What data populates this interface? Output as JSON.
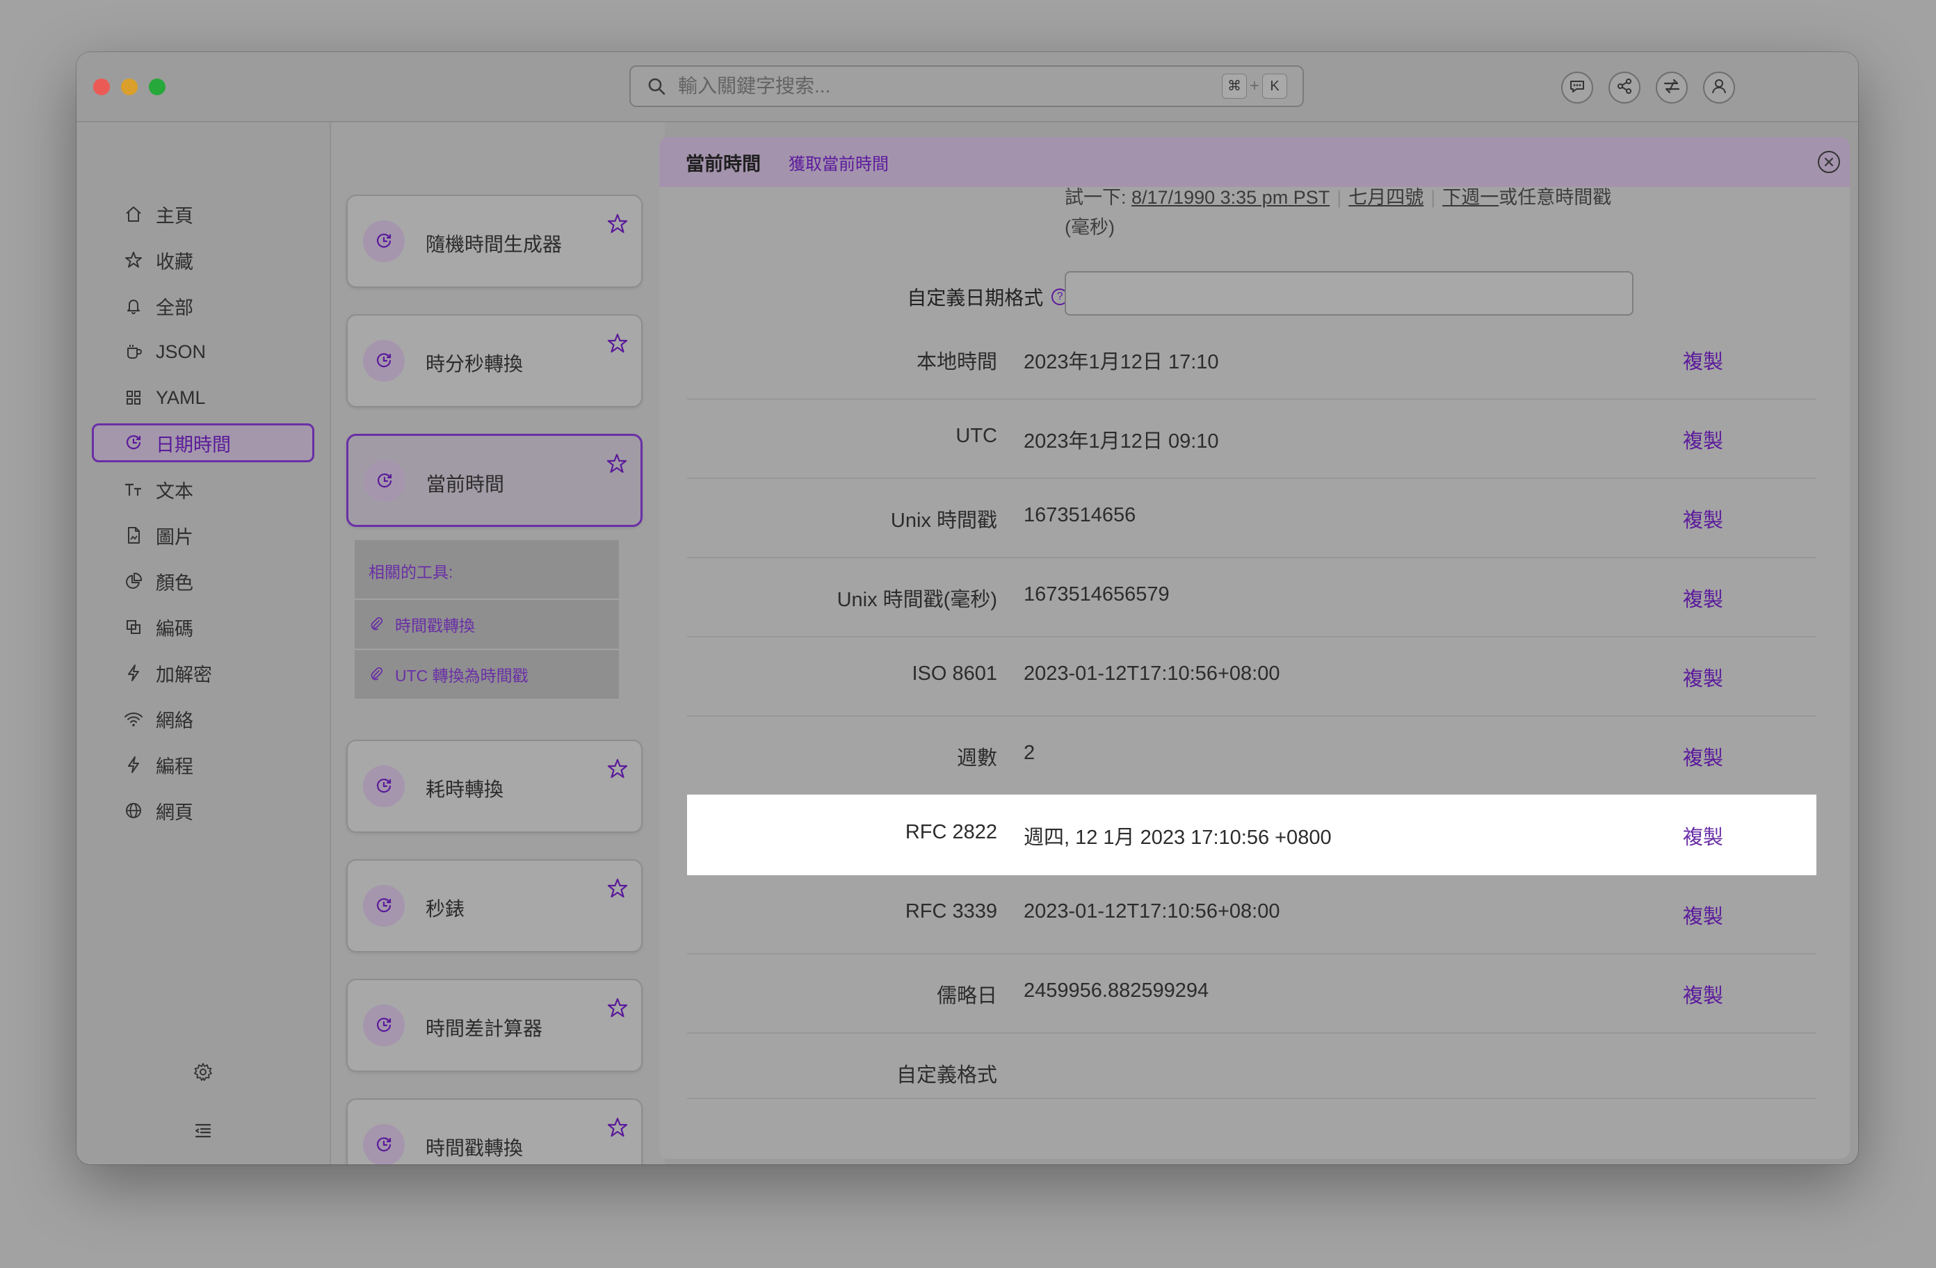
{
  "search": {
    "placeholder": "輸入關鍵字搜索...",
    "kbd_cmd": "⌘",
    "kbd_plus": "+",
    "kbd_k": "K"
  },
  "sidebar": {
    "items": [
      {
        "label": "主頁",
        "icon": "home-icon"
      },
      {
        "label": "收藏",
        "icon": "star-icon"
      },
      {
        "label": "全部",
        "icon": "bell-icon"
      },
      {
        "label": "JSON",
        "icon": "cup-icon"
      },
      {
        "label": "YAML",
        "icon": "grid-icon"
      },
      {
        "label": "日期時間",
        "icon": "clock-icon",
        "active": true
      },
      {
        "label": "文本",
        "icon": "text-icon"
      },
      {
        "label": "圖片",
        "icon": "file-icon"
      },
      {
        "label": "顏色",
        "icon": "pie-icon"
      },
      {
        "label": "編碼",
        "icon": "copy-icon"
      },
      {
        "label": "加解密",
        "icon": "bolt-icon"
      },
      {
        "label": "網絡",
        "icon": "wifi-icon"
      },
      {
        "label": "編程",
        "icon": "bolt-icon"
      },
      {
        "label": "網頁",
        "icon": "globe-icon"
      }
    ]
  },
  "tools": {
    "cards": [
      {
        "label": "隨機時間生成器"
      },
      {
        "label": "時分秒轉換"
      },
      {
        "label": "當前時間",
        "active": true
      },
      {
        "label": "耗時轉換"
      },
      {
        "label": "秒錶"
      },
      {
        "label": "時間差計算器"
      },
      {
        "label": "時間戳轉換"
      }
    ],
    "related": {
      "heading": "相關的工具:",
      "links": [
        "時間戳轉換",
        "UTC 轉換為時間戳"
      ]
    }
  },
  "panel": {
    "title": "當前時間",
    "subtitle": "獲取當前時間",
    "hint_prefix": "試一下: ",
    "hint_link1": "8/17/1990 3:35 pm PST",
    "hint_link2": "七月四號",
    "hint_link3": "下週一",
    "hint_suffix": "或任意時間戳(毫秒)",
    "custom_format_label": "自定義日期格式",
    "custom_format_value": "",
    "rows": [
      {
        "key": "本地時間",
        "value": "2023年1月12日 17:10",
        "copy": "複製"
      },
      {
        "key": "UTC",
        "value": "2023年1月12日 09:10",
        "copy": "複製"
      },
      {
        "key": "Unix 時間戳",
        "value": "1673514656",
        "copy": "複製"
      },
      {
        "key": "Unix 時間戳(毫秒)",
        "value": "1673514656579",
        "copy": "複製"
      },
      {
        "key": "ISO 8601",
        "value": "2023-01-12T17:10:56+08:00",
        "copy": "複製"
      },
      {
        "key": "週數",
        "value": "2",
        "copy": "複製"
      },
      {
        "key": "RFC 2822",
        "value": "週四, 12 1月 2023 17:10:56 +0800",
        "copy": "複製",
        "highlighted": true
      },
      {
        "key": "RFC 3339",
        "value": "2023-01-12T17:10:56+08:00",
        "copy": "複製"
      },
      {
        "key": "儒略日",
        "value": "2459956.882599294",
        "copy": "複製"
      },
      {
        "key": "自定義格式",
        "value": "",
        "copy": ""
      }
    ]
  },
  "colors": {
    "accent": "#6a2fa6",
    "overlay": "#9c9c9c",
    "highlight_row": "#ffffff"
  }
}
